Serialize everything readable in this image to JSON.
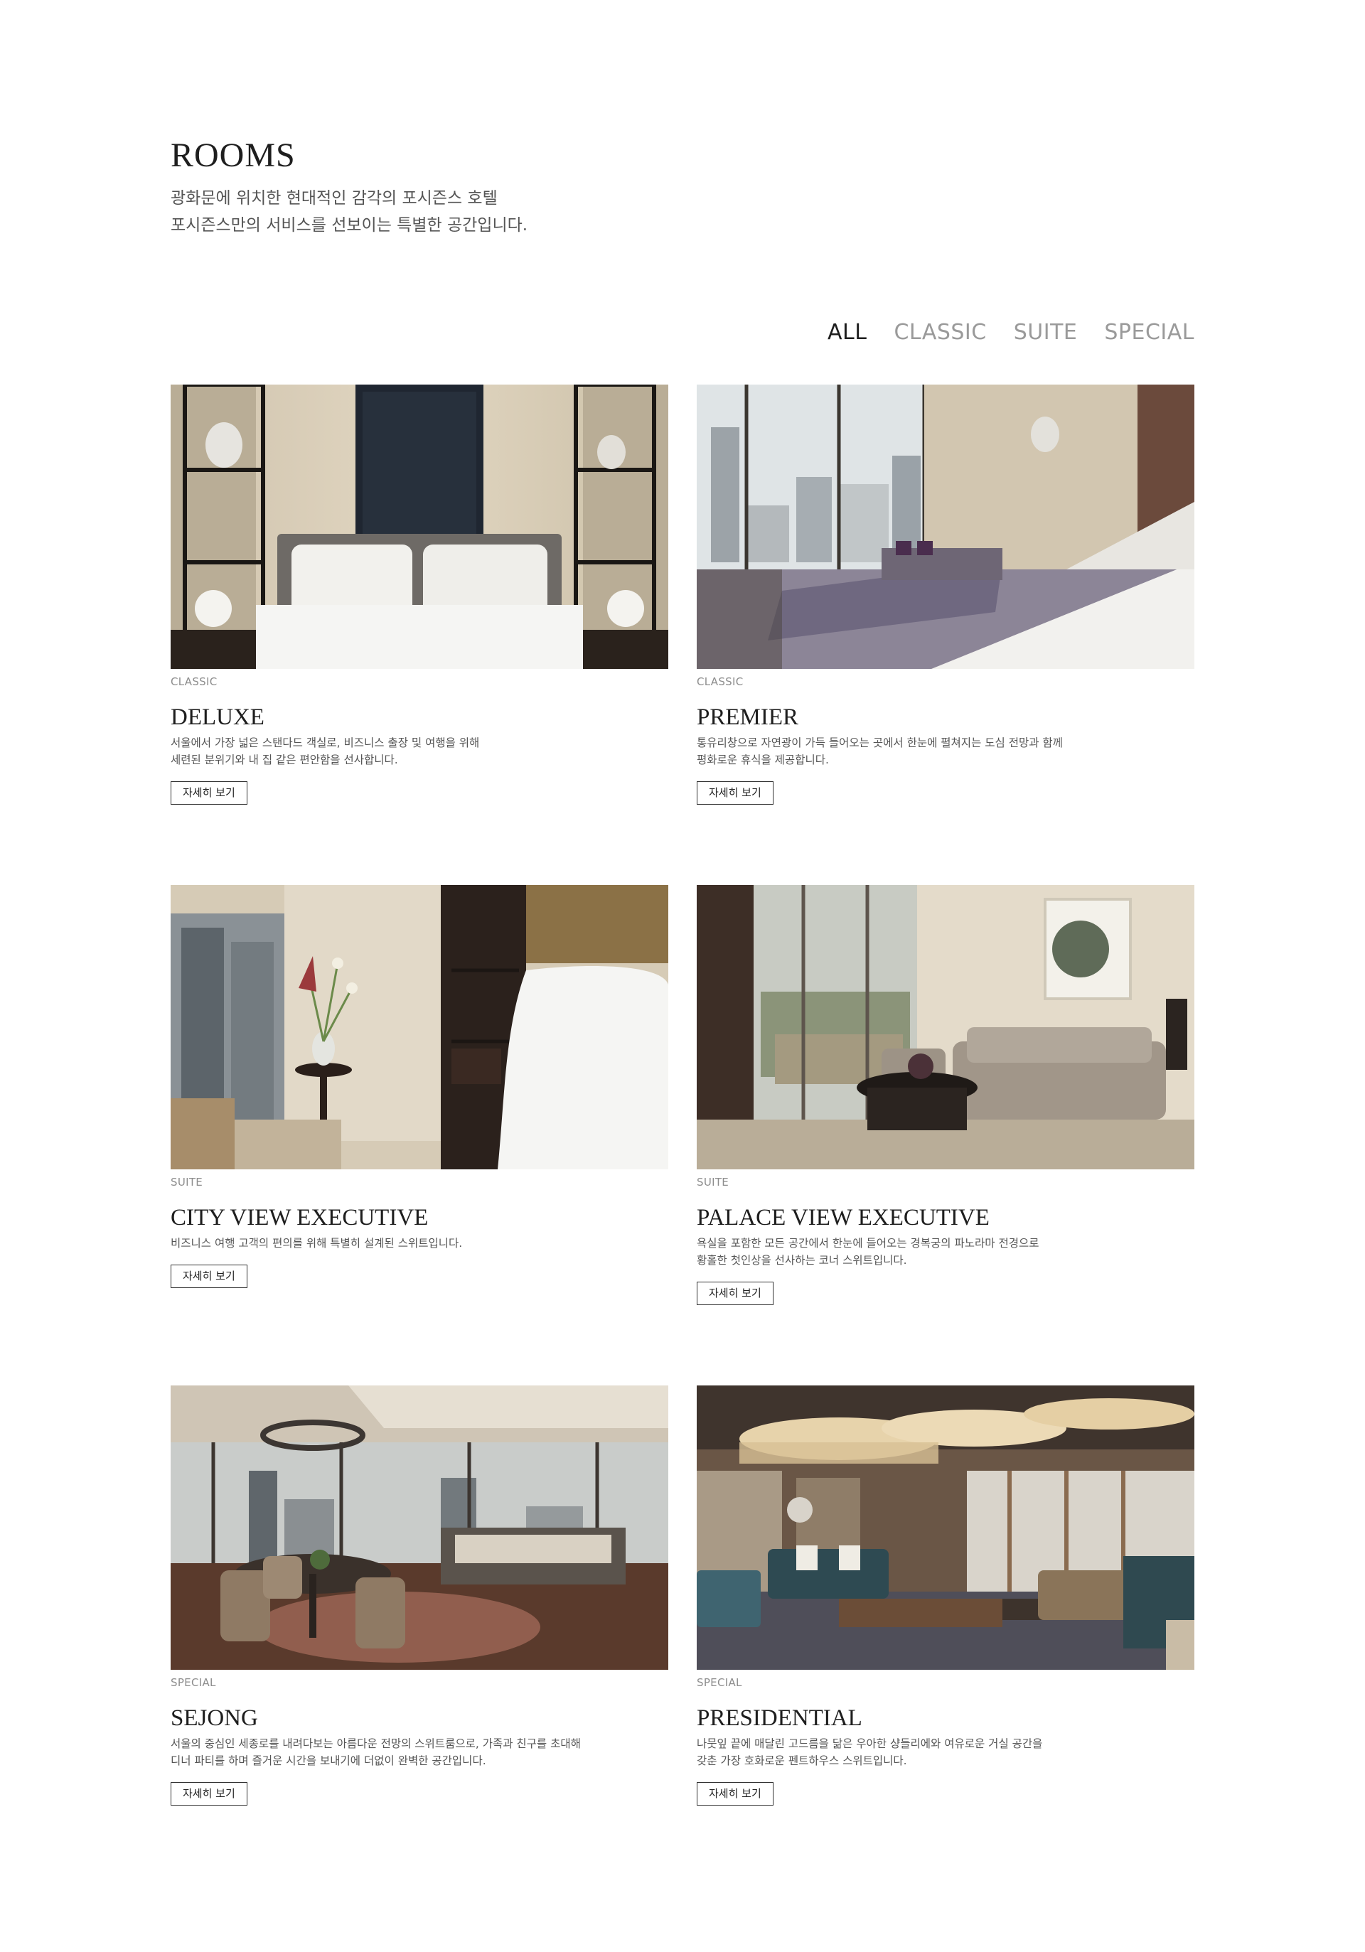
{
  "header": {
    "title": "ROOMS",
    "intro_line1": "광화문에 위치한 현대적인 감각의 포시즌스 호텔",
    "intro_line2": "포시즌스만의 서비스를 선보이는 특별한 공간입니다."
  },
  "filters": [
    {
      "label": "ALL",
      "active": true
    },
    {
      "label": "CLASSIC",
      "active": false
    },
    {
      "label": "SUITE",
      "active": false
    },
    {
      "label": "SPECIAL",
      "active": false
    }
  ],
  "rooms": [
    {
      "category": "CLASSIC",
      "title": "DELUXE",
      "desc_line1": "서울에서 가장 넓은 스탠다드 객실로, 비즈니스 출장 및 여행을 위해",
      "desc_line2": "세련된 분위기와 내 집 같은 편안함을 선사합니다.",
      "button": "자세히 보기"
    },
    {
      "category": "CLASSIC",
      "title": "PREMIER",
      "desc_line1": "통유리창으로 자연광이 가득 들어오는 곳에서 한눈에 펼쳐지는 도심 전망과 함께",
      "desc_line2": "평화로운 휴식을  제공합니다.",
      "button": "자세히 보기"
    },
    {
      "category": "SUITE",
      "title": "CITY VIEW EXECUTIVE",
      "desc_line1": "비즈니스 여행 고객의 편의를 위해 특별히 설계된 스위트입니다.",
      "desc_line2": "",
      "button": "자세히 보기"
    },
    {
      "category": "SUITE",
      "title": "PALACE VIEW EXECUTIVE",
      "desc_line1": "욕실을 포함한 모든 공간에서 한눈에 들어오는 경복궁의 파노라마 전경으로",
      "desc_line2": "황홀한 첫인상을 선사하는 코너 스위트입니다.",
      "button": "자세히 보기"
    },
    {
      "category": "SPECIAL",
      "title": "SEJONG",
      "desc_line1": "서울의 중심인 세종로를 내려다보는 아름다운 전망의 스위트룸으로, 가족과 친구를 초대해",
      "desc_line2": "디너 파티를 하며 즐거운 시간을 보내기에 더없이 완벽한 공간입니다.",
      "button": "자세히 보기"
    },
    {
      "category": "SPECIAL",
      "title": "PRESIDENTIAL",
      "desc_line1": "나뭇잎 끝에 매달린 고드름을 닮은 우아한 샹들리에와 여유로운 거실 공간을",
      "desc_line2": "갖춘 가장 호화로운 펜트하우스 스위트입니다.",
      "button": "자세히 보기"
    }
  ]
}
